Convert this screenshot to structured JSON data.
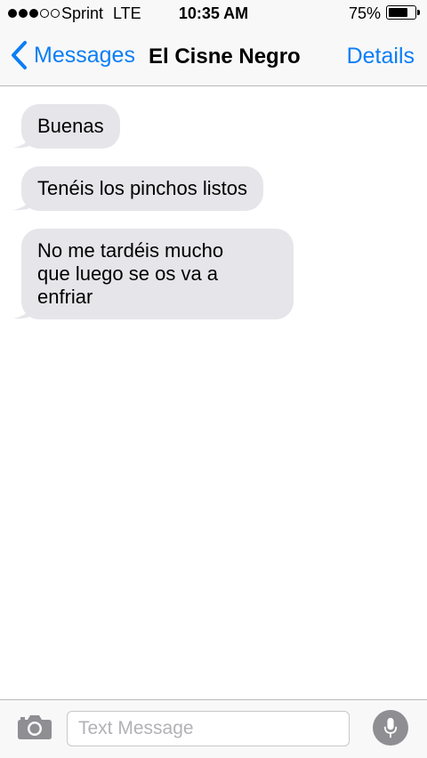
{
  "status_bar": {
    "carrier": "Sprint",
    "network": "LTE",
    "time": "10:35 AM",
    "battery_percent": "75%",
    "battery_level": 0.75,
    "signal_bars_filled": 3,
    "signal_bars_total": 5
  },
  "nav": {
    "back_label": "Messages",
    "title": "El Cisne Negro",
    "details_label": "Details"
  },
  "messages": [
    {
      "direction": "incoming",
      "text": "Buenas"
    },
    {
      "direction": "incoming",
      "text": "Tenéis los pinchos listos"
    },
    {
      "direction": "incoming",
      "lines": [
        "No me tardéis mucho",
        "que luego se os va a",
        "enfriar"
      ]
    }
  ],
  "composer": {
    "placeholder": "Text Message"
  },
  "icons": {
    "back": "chevron-left-icon",
    "camera": "camera-icon",
    "mic": "microphone-icon"
  },
  "colors": {
    "accent": "#0b7ef5",
    "incoming_bubble": "#e5e5ea",
    "bar_background": "#f8f8f8",
    "mic_button": "#8e8e93"
  }
}
